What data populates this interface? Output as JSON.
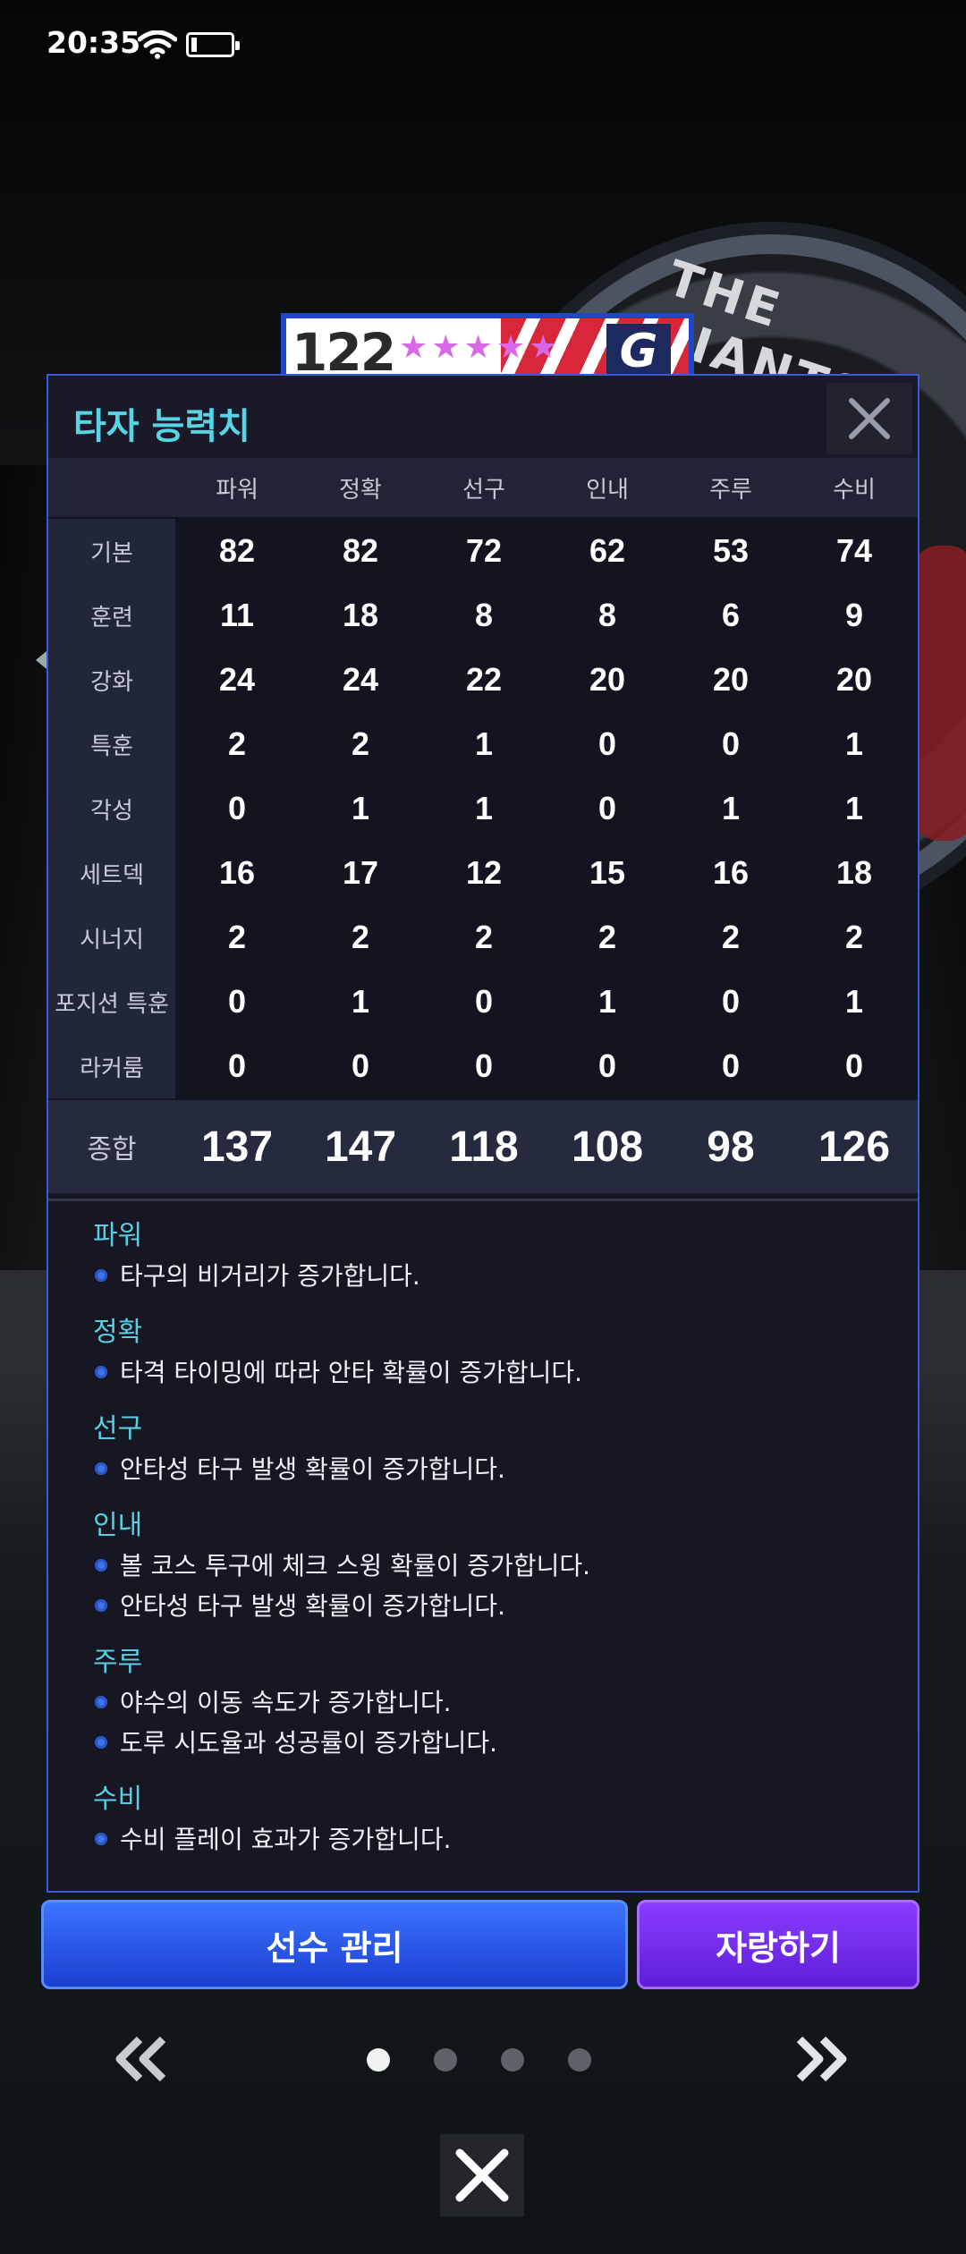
{
  "status_bar": {
    "time": "20:35"
  },
  "background": {
    "team_logo_text": "THE GIANTS"
  },
  "player_card": {
    "number": "122",
    "stars": "★★★★★",
    "team_badge": "G"
  },
  "dialog": {
    "title": "타자 능력치",
    "columns": [
      "파워",
      "정확",
      "선구",
      "인내",
      "주루",
      "수비"
    ],
    "rows": [
      {
        "label": "기본",
        "values": [
          "82",
          "82",
          "72",
          "62",
          "53",
          "74"
        ]
      },
      {
        "label": "훈련",
        "values": [
          "11",
          "18",
          "8",
          "8",
          "6",
          "9"
        ]
      },
      {
        "label": "강화",
        "values": [
          "24",
          "24",
          "22",
          "20",
          "20",
          "20"
        ]
      },
      {
        "label": "특훈",
        "values": [
          "2",
          "2",
          "1",
          "0",
          "0",
          "1"
        ]
      },
      {
        "label": "각성",
        "values": [
          "0",
          "1",
          "1",
          "0",
          "1",
          "1"
        ]
      },
      {
        "label": "세트덱",
        "values": [
          "16",
          "17",
          "12",
          "15",
          "16",
          "18"
        ]
      },
      {
        "label": "시너지",
        "values": [
          "2",
          "2",
          "2",
          "2",
          "2",
          "2"
        ]
      },
      {
        "label": "포지션 특훈",
        "values": [
          "0",
          "1",
          "0",
          "1",
          "0",
          "1"
        ]
      },
      {
        "label": "라커룸",
        "values": [
          "0",
          "0",
          "0",
          "0",
          "0",
          "0"
        ]
      }
    ],
    "total": {
      "label": "종합",
      "values": [
        "137",
        "147",
        "118",
        "108",
        "98",
        "126"
      ]
    },
    "descriptions": [
      {
        "title": "파워",
        "items": [
          "타구의 비거리가 증가합니다."
        ]
      },
      {
        "title": "정확",
        "items": [
          "타격 타이밍에 따라 안타 확률이 증가합니다."
        ]
      },
      {
        "title": "선구",
        "items": [
          "안타성 타구 발생 확률이 증가합니다."
        ]
      },
      {
        "title": "인내",
        "items": [
          "볼 코스 투구에 체크 스윙 확률이 증가합니다.",
          "안타성 타구 발생 확률이 증가합니다."
        ]
      },
      {
        "title": "주루",
        "items": [
          "야수의 이동 속도가 증가합니다.",
          "도루 시도율과 성공률이 증가합니다."
        ]
      },
      {
        "title": "수비",
        "items": [
          "수비 플레이 효과가 증가합니다."
        ]
      }
    ]
  },
  "buttons": {
    "manage_label": "선수 관리",
    "boast_label": "자랑하기"
  },
  "pager": {
    "page_count": 4,
    "current_page": 1
  }
}
